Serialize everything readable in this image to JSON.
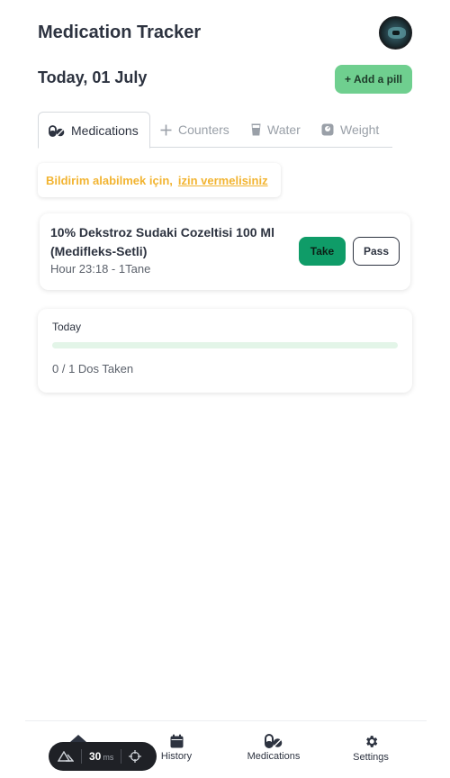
{
  "header": {
    "title": "Medication Tracker",
    "avatar_icon": "profile-avatar"
  },
  "date_row": {
    "date": "Today, 01 July",
    "add_pill_label": "+ Add a pill"
  },
  "tabs": [
    {
      "label": "Medications",
      "icon": "pills-icon",
      "active": true
    },
    {
      "label": "Counters",
      "icon": "plus-icon",
      "active": false
    },
    {
      "label": "Water",
      "icon": "glass-icon",
      "active": false
    },
    {
      "label": "Weight",
      "icon": "scale-icon",
      "active": false
    }
  ],
  "notice": {
    "text": "Bildirim alabilmek için,",
    "link": "izin vermelisiniz",
    "color": "#f2b431"
  },
  "medication": {
    "name": "10% Dekstroz Sudaki Cozeltisi 100 Ml (Medifleks-Setli)",
    "meta": "Hour 23:18 - 1Tane",
    "take_label": "Take",
    "pass_label": "Pass"
  },
  "progress": {
    "label": "Today",
    "taken": 0,
    "total": 1,
    "fraction": 0,
    "count_text": "0 / 1 Dos Taken"
  },
  "bottom_nav": [
    {
      "label": "",
      "icon": "home-icon"
    },
    {
      "label": "History",
      "icon": "calendar-icon"
    },
    {
      "label": "Medications",
      "icon": "pills-icon"
    },
    {
      "label": "Settings",
      "icon": "gear-icon"
    }
  ],
  "devtools": {
    "value": "30",
    "unit": "ms"
  },
  "colors": {
    "accent_green": "#6fcf8f",
    "take_green": "#0f9c68",
    "warning_yellow": "#f2b431",
    "text_dark": "#2d3340"
  }
}
